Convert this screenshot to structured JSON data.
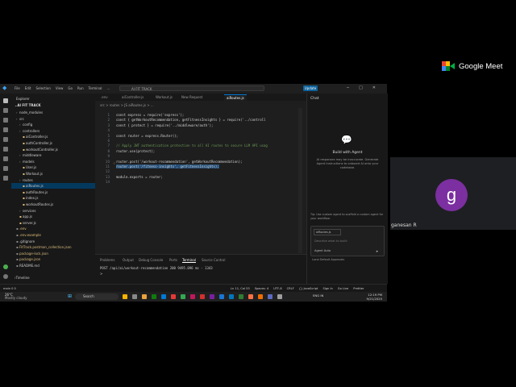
{
  "meet": {
    "title": "Google Meet",
    "participant": {
      "initial": "g",
      "name": "ganesan R"
    }
  },
  "vscode": {
    "menu": [
      "File",
      "Edit",
      "Selection",
      "View",
      "Go",
      "Run",
      "Terminal",
      "..."
    ],
    "search": "AI FIT TRACK",
    "update_label": "Update",
    "sidebar": {
      "header": "Explorer",
      "root": "AI FIT TRACK",
      "items": [
        {
          "label": "node_modules",
          "type": "folder",
          "depth": 1
        },
        {
          "label": "src",
          "type": "folder",
          "depth": 1
        },
        {
          "label": "config",
          "type": "folder",
          "depth": 2
        },
        {
          "label": "controllers",
          "type": "folder",
          "depth": 2
        },
        {
          "label": "aiController.js",
          "type": "file",
          "depth": 3
        },
        {
          "label": "authController.js",
          "type": "file",
          "depth": 3
        },
        {
          "label": "workoutController.js",
          "type": "file",
          "depth": 3
        },
        {
          "label": "middleware",
          "type": "folder",
          "depth": 2
        },
        {
          "label": "models",
          "type": "folder",
          "depth": 2
        },
        {
          "label": "User.js",
          "type": "file",
          "depth": 3
        },
        {
          "label": "Workout.js",
          "type": "file",
          "depth": 3
        },
        {
          "label": "routes",
          "type": "folder",
          "depth": 2
        },
        {
          "label": "aiRoutes.js",
          "type": "file",
          "depth": 3,
          "selected": true
        },
        {
          "label": "authRoutes.js",
          "type": "file",
          "depth": 3
        },
        {
          "label": "index.js",
          "type": "file",
          "depth": 3
        },
        {
          "label": "workoutRoutes.js",
          "type": "file",
          "depth": 3
        },
        {
          "label": "services",
          "type": "folder",
          "depth": 2
        },
        {
          "label": "app.js",
          "type": "file",
          "depth": 2
        },
        {
          "label": "server.js",
          "type": "file",
          "depth": 2
        },
        {
          "label": ".env",
          "type": "file",
          "depth": 1
        },
        {
          "label": ".env.example",
          "type": "file",
          "depth": 1
        },
        {
          "label": ".gitignore",
          "type": "file",
          "depth": 1
        },
        {
          "label": "FitTrack.postman_collection.json",
          "type": "file",
          "depth": 1
        },
        {
          "label": "package-lock.json",
          "type": "file",
          "depth": 1
        },
        {
          "label": "package.json",
          "type": "file",
          "depth": 1
        },
        {
          "label": "README.md",
          "type": "file",
          "depth": 1
        }
      ],
      "timeline": "Timeline"
    },
    "tabs": [
      ".env",
      "aiController.js",
      "Workout.js",
      "New Request",
      "aiRoutes.js"
    ],
    "breadcrumb": "src > routes > JS aiRoutes.js > ...",
    "code": [
      "const express = require('express');",
      "const { getWorkoutRecommendation, getFitnessInsights } = require('../controll",
      "const { protect } = require('../middleware/auth');",
      "",
      "const router = express.Router();",
      "",
      "// Apply JWT authentication protection to all AI routes to secure LLM API usag",
      "router.use(protect);",
      "",
      "router.post('/workout-recommendation', getWorkoutRecommendation);",
      "router.post('/fitness-insights', getFitnessInsights);",
      "",
      "module.exports = router;",
      ""
    ],
    "chat": {
      "title": "Chat",
      "heading": "Build with Agent",
      "description": "AI responses may be inaccurate. Generate Agent Instructions to onboard AI onto your codebase.",
      "tip": "Tip: Use custom agent to scaffold a custom agent for your workflow.",
      "file_chip": "aiRoutes.js",
      "placeholder": "Describe what to build",
      "mode": "Agent   Auto",
      "footer": "Local     Default Approvals"
    },
    "panel": {
      "tabs": [
        "Problems",
        "Output",
        "Debug Console",
        "Ports",
        "Terminal",
        "Source Control"
      ],
      "active_tab": "Terminal",
      "terminal_line": "POST /api/ai/workout-recommendation 200 9495.096 ms - 1343",
      "prompt": ">"
    },
    "status": {
      "left": "main   0 0",
      "right": [
        "Ln 11, Col 53",
        "Spaces: 4",
        "UTF-8",
        "CRLF",
        "{} JavaScript",
        "Sign In",
        "Go Live",
        "Prettier"
      ]
    }
  },
  "taskbar": {
    "weather_temp": "26°C",
    "weather_desc": "Mostly cloudy",
    "search": "Search",
    "lang": "ENG IN",
    "time": "12:19 PM",
    "date": "9/21/2025"
  }
}
